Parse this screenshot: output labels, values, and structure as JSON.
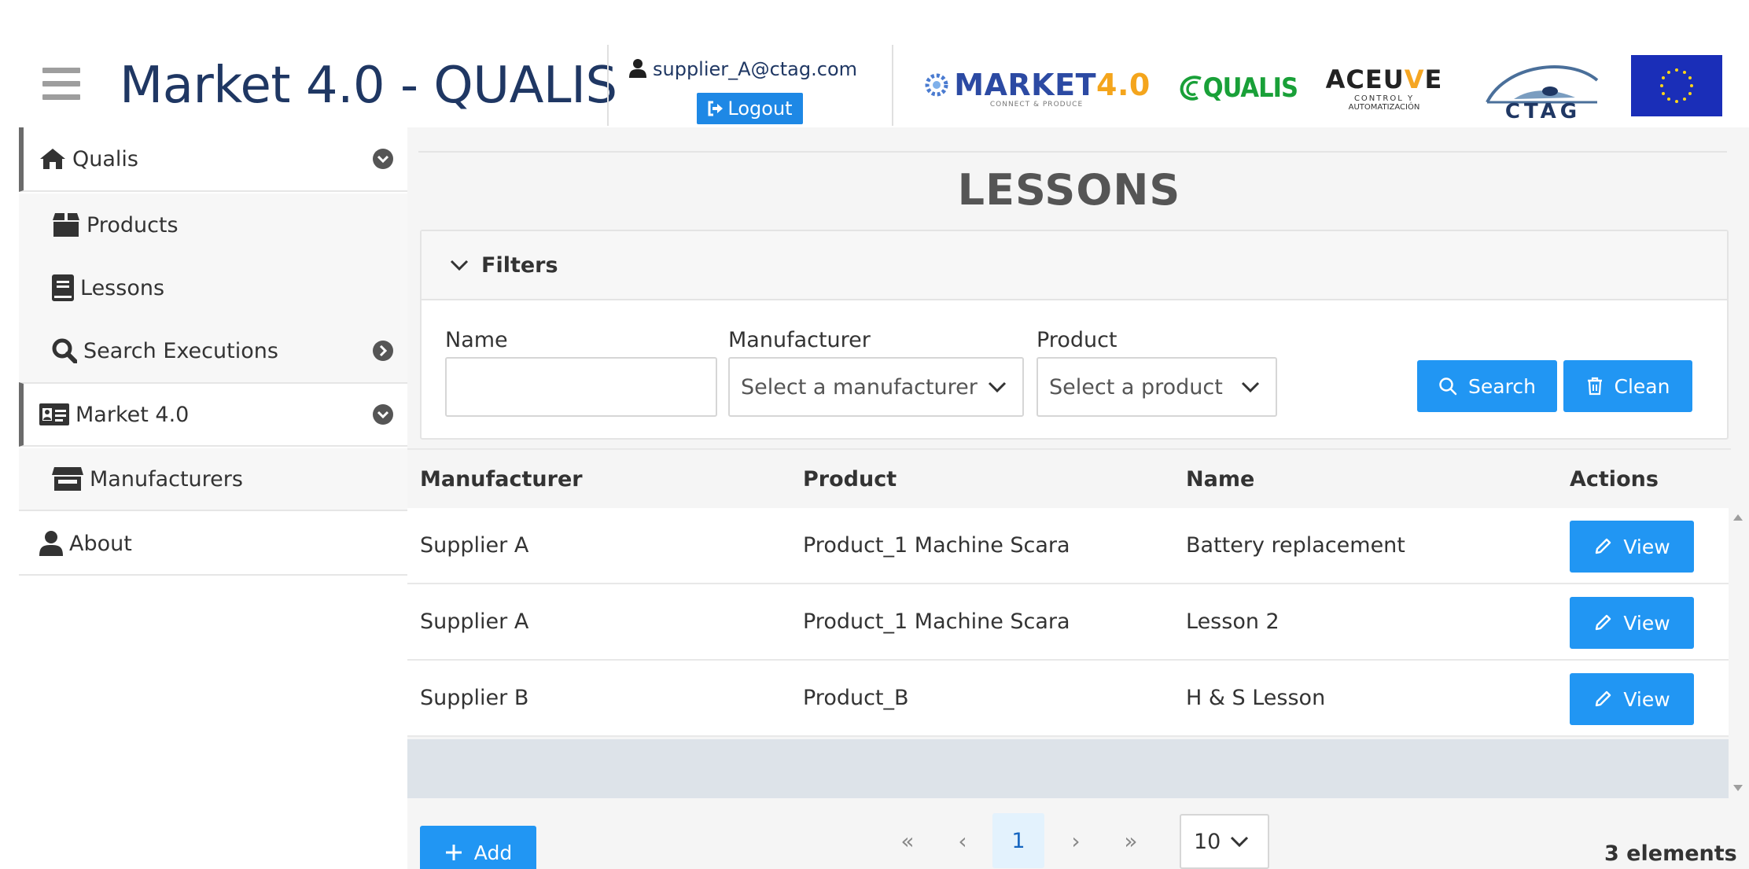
{
  "header": {
    "app_title": "Market 4.0 - QUALIS",
    "user_email": "supplier_A@ctag.com",
    "logout_label": "Logout",
    "logos": {
      "market_main": "MARKET",
      "market_four": "4.0",
      "market_sub": "CONNECT & PRODUCE",
      "qualis": "QUALIS",
      "aceuve_main_a": "ACEU",
      "aceuve_main_v": "V",
      "aceuve_main_e": "E",
      "aceuve_line1": "CONTROL Y",
      "aceuve_line2": "AUTOMATIZACIÓN",
      "ctag": "CTAG"
    }
  },
  "sidebar": {
    "items": [
      {
        "label": "Qualis",
        "icon": "home-icon",
        "type": "group",
        "expanded": true
      },
      {
        "label": "Products",
        "icon": "box-icon",
        "type": "sub"
      },
      {
        "label": "Lessons",
        "icon": "book-icon",
        "type": "sub"
      },
      {
        "label": "Search Executions",
        "icon": "search-icon",
        "type": "sub",
        "has_children": true
      },
      {
        "label": "Market 4.0",
        "icon": "id-card-icon",
        "type": "group",
        "expanded": true
      },
      {
        "label": "Manufacturers",
        "icon": "store-icon",
        "type": "sub"
      },
      {
        "label": "About",
        "icon": "user-icon",
        "type": "group"
      }
    ]
  },
  "main": {
    "title": "LESSONS",
    "filters": {
      "heading": "Filters",
      "name_label": "Name",
      "name_value": "",
      "manufacturer_label": "Manufacturer",
      "manufacturer_placeholder": "Select a manufacturer",
      "product_label": "Product",
      "product_placeholder": "Select a product",
      "search_label": "Search",
      "clean_label": "Clean"
    },
    "table": {
      "columns": [
        "Manufacturer",
        "Product",
        "Name",
        "Actions"
      ],
      "rows": [
        {
          "manufacturer": "Supplier A",
          "product": "Product_1 Machine Scara",
          "name": "Battery replacement",
          "action": "View"
        },
        {
          "manufacturer": "Supplier A",
          "product": "Product_1 Machine Scara",
          "name": "Lesson 2",
          "action": "View"
        },
        {
          "manufacturer": "Supplier B",
          "product": "Product_B",
          "name": "H & S Lesson",
          "action": "View"
        }
      ]
    },
    "footer": {
      "add_label": "Add",
      "current_page": "1",
      "rows_per_page": "10",
      "count_label": "3 elements"
    }
  },
  "colors": {
    "brand_blue": "#2196f3",
    "title_navy": "#1f3763",
    "qualis_green": "#19a038",
    "market_orange": "#f4a51c"
  }
}
